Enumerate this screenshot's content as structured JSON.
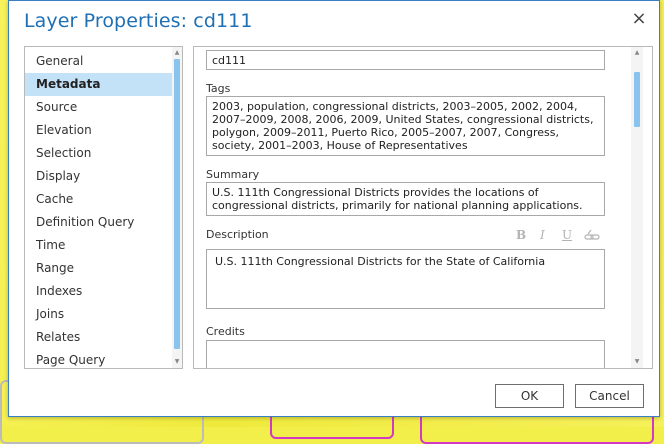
{
  "dialog": {
    "title": "Layer Properties: cd111",
    "close_glyph": "×"
  },
  "nav": {
    "items": [
      {
        "label": "General",
        "selected": false
      },
      {
        "label": "Metadata",
        "selected": true
      },
      {
        "label": "Source",
        "selected": false
      },
      {
        "label": "Elevation",
        "selected": false
      },
      {
        "label": "Selection",
        "selected": false
      },
      {
        "label": "Display",
        "selected": false
      },
      {
        "label": "Cache",
        "selected": false
      },
      {
        "label": "Definition Query",
        "selected": false
      },
      {
        "label": "Time",
        "selected": false
      },
      {
        "label": "Range",
        "selected": false
      },
      {
        "label": "Indexes",
        "selected": false
      },
      {
        "label": "Joins",
        "selected": false
      },
      {
        "label": "Relates",
        "selected": false
      },
      {
        "label": "Page Query",
        "selected": false
      }
    ]
  },
  "metadata": {
    "title_value": "cd111",
    "tags_label": "Tags",
    "tags_value": "2003, population, congressional districts, 2003–2005, 2002, 2004, 2007–2009, 2008, 2006, 2009, United States, congressional districts, polygon, 2009–2011, Puerto Rico, 2005–2007, 2007, Congress, society, 2001–2003, House of Representatives",
    "summary_label": "Summary",
    "summary_value": "U.S. 111th Congressional Districts provides the locations of congressional districts, primarily for national planning applications.",
    "description_label": "Description",
    "description_value": "U.S. 111th Congressional Districts for the State of California",
    "format": {
      "bold": "B",
      "italic": "I",
      "underline": "U"
    },
    "credits_label": "Credits",
    "credits_value": ""
  },
  "buttons": {
    "ok": "OK",
    "cancel": "Cancel"
  },
  "colors": {
    "title": "#1f6fb5",
    "selected_item": "#c3e1f7",
    "scroll_thumb": "#8ac4ee",
    "dialog_border": "#3a7fc1"
  }
}
